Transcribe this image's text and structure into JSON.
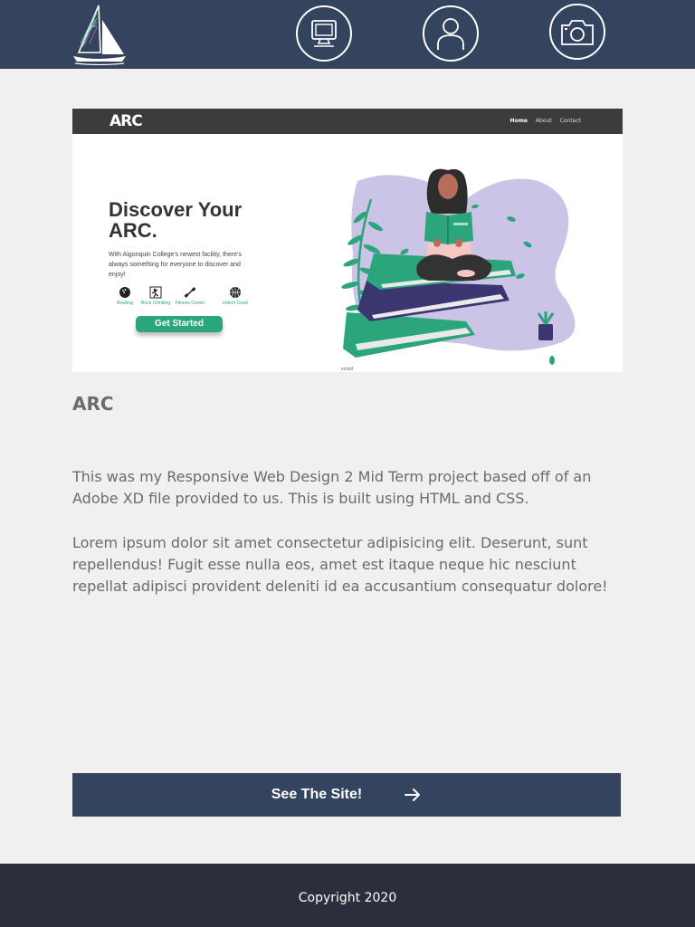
{
  "header": {
    "nav": [
      {
        "icon": "computer-icon"
      },
      {
        "icon": "user-icon"
      },
      {
        "icon": "camera-icon"
      }
    ]
  },
  "preview": {
    "brand": "ARC",
    "links": [
      "Home",
      "About",
      "Contact"
    ],
    "active_link": "Home",
    "heading": "Discover Your ARC.",
    "subtext": "With Algonquin College's newest facility, there's always something for everyone to discover and enjoy!",
    "features": [
      "Bowling",
      "Rock Climbing",
      "Fitness Center",
      "Indoor Court"
    ],
    "cta": "Get Started",
    "scroll_label": "scroll",
    "accent_color": "#2aa57c"
  },
  "project": {
    "title": "ARC",
    "description_1": "This was my Responsive Web Design 2 Mid Term project based off of an Adobe XD file provided to us. This is built using HTML and CSS.",
    "description_2": "Lorem ipsum dolor sit amet consectetur adipisicing elit. Deserunt, sunt repellendus! Fugit esse nulla eos, amet est itaque neque hic nesciunt repellat adipisci provident deleniti id ea accusantium consequatur dolore!",
    "button_label": "See The Site!",
    "button_icon": "arrow-right-icon"
  },
  "footer": {
    "copyright": "Copyright 2020"
  },
  "colors": {
    "header_bg": "#34435e",
    "footer_bg": "#2b2f3b",
    "page_bg": "#f0f0f0"
  }
}
